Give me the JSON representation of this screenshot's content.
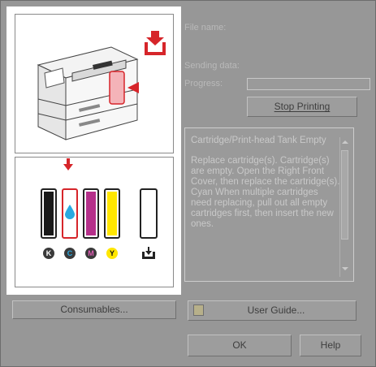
{
  "labels": {
    "file_name": "File name:",
    "sending_data": "Sending data:",
    "progress": "Progress:"
  },
  "buttons": {
    "stop_printing": "Stop Printing",
    "consumables": "Consumables...",
    "user_guide": "User Guide...",
    "ok": "OK",
    "help": "Help"
  },
  "status": {
    "title": "Cartridge/Print-head Tank Empty",
    "message": "Replace cartridge(s). Cartridge(s) are empty. Open the Right Front Cover, then replace the cartridge(s). Cyan When multiple cartridges need replacing, pull out all empty cartridges first, then insert the new ones."
  },
  "cartridges": [
    {
      "letter": "K",
      "color": "#1a1a1a"
    },
    {
      "letter": "C",
      "color": "#29a9e0"
    },
    {
      "letter": "M",
      "color": "#b5308a"
    },
    {
      "letter": "Y",
      "color": "#ffe600"
    }
  ],
  "colors": {
    "alert": "#d6252a"
  }
}
